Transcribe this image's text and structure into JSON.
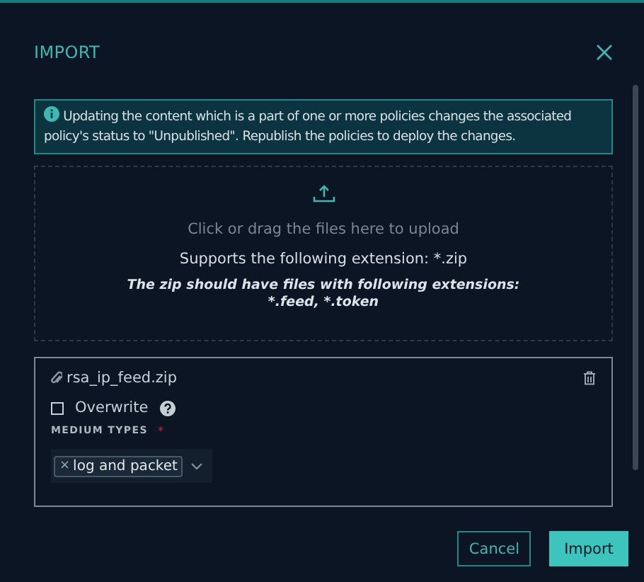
{
  "dialog": {
    "title": "IMPORT"
  },
  "alert": {
    "text": "Updating the content which is a part of one or more policies changes the associated policy's status to \"Unpublished\". Republish the policies to deploy the changes."
  },
  "dropzone": {
    "hint": "Click or drag the files here to upload",
    "extension_note": "Supports the following extension: *.zip",
    "content_note": [
      "The zip should have files with following extensions:",
      "*.feed, *.token"
    ]
  },
  "file": {
    "name": "rsa_ip_feed.zip",
    "overwrite": {
      "label": "Overwrite",
      "checked": false
    },
    "medium_types": {
      "label": "MEDIUM TYPES",
      "required_mark": "*",
      "tags": [
        {
          "remove": "×",
          "label": "log and packet"
        }
      ]
    }
  },
  "buttons": [
    {
      "label": "Cancel",
      "kind": "secondary"
    },
    {
      "label": "Import",
      "kind": "primary"
    }
  ]
}
